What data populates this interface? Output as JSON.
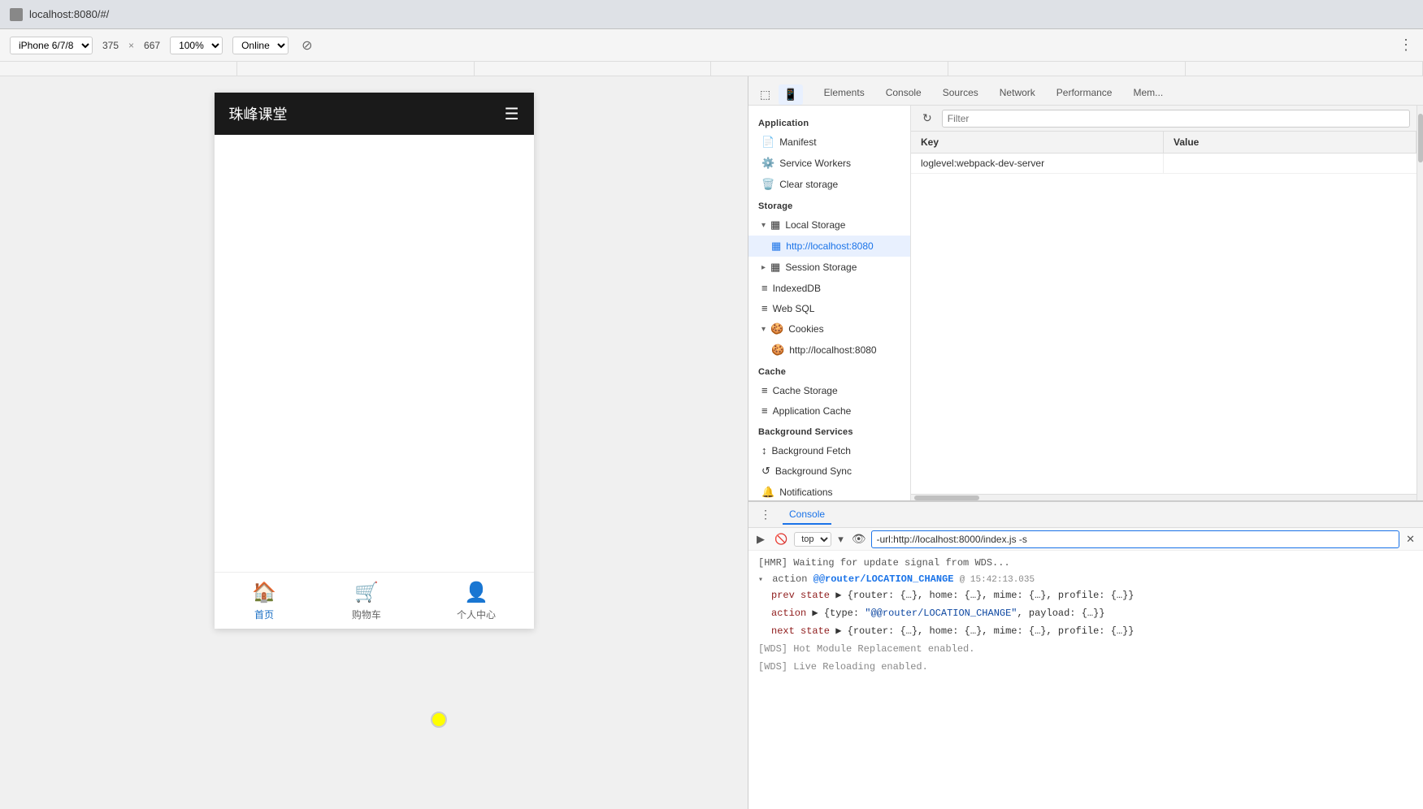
{
  "browser": {
    "url": "localhost:8080/#/",
    "favicon": "globe"
  },
  "device_toolbar": {
    "device": "iPhone 6/7/8",
    "width": "375",
    "separator": "×",
    "height": "667",
    "zoom": "100%",
    "zoom_dropdown_label": "100%",
    "network": "Online",
    "rotate_label": "⊘",
    "more_label": "⋮"
  },
  "phone": {
    "header_title": "珠峰课堂",
    "menu_icon": "☰",
    "nav_items": [
      {
        "label": "首页",
        "active": true
      },
      {
        "label": "购物车",
        "active": false
      },
      {
        "label": "个人中心",
        "active": false
      }
    ]
  },
  "devtools": {
    "tabs": [
      {
        "label": "Elements"
      },
      {
        "label": "Console"
      },
      {
        "label": "Sources"
      },
      {
        "label": "Network"
      },
      {
        "label": "Performance"
      },
      {
        "label": "Mem..."
      }
    ],
    "active_tab": "Elements",
    "toolbar_icons": [
      "inspect",
      "device"
    ],
    "application_panel": {
      "title": "Application",
      "sections": [
        {
          "label": "",
          "items": [
            {
              "label": "Manifest",
              "icon": "📄",
              "indent": 0
            },
            {
              "label": "Service Workers",
              "icon": "⚙️",
              "indent": 0
            },
            {
              "label": "Clear storage",
              "icon": "🗑️",
              "indent": 0
            }
          ]
        },
        {
          "label": "Storage",
          "items": [
            {
              "label": "Local Storage",
              "icon": "▦",
              "indent": 0,
              "expanded": true
            },
            {
              "label": "http://localhost:8080",
              "icon": "▦",
              "indent": 1,
              "active": true
            },
            {
              "label": "Session Storage",
              "icon": "▦",
              "indent": 0,
              "expanded": false
            },
            {
              "label": "IndexedDB",
              "icon": "≡",
              "indent": 0
            },
            {
              "label": "Web SQL",
              "icon": "≡",
              "indent": 0
            },
            {
              "label": "Cookies",
              "icon": "🍪",
              "indent": 0,
              "expanded": true
            },
            {
              "label": "http://localhost:8080",
              "icon": "🍪",
              "indent": 1
            }
          ]
        },
        {
          "label": "Cache",
          "items": [
            {
              "label": "Cache Storage",
              "icon": "≡",
              "indent": 0
            },
            {
              "label": "Application Cache",
              "icon": "≡",
              "indent": 0
            }
          ]
        },
        {
          "label": "Background Services",
          "items": [
            {
              "label": "Background Fetch",
              "icon": "↕",
              "indent": 0
            },
            {
              "label": "Background Sync",
              "icon": "↺",
              "indent": 0
            },
            {
              "label": "Notifications",
              "icon": "🔔",
              "indent": 0
            }
          ]
        }
      ],
      "filter_placeholder": "Filter",
      "storage_table": {
        "columns": [
          "Key",
          "Value"
        ],
        "rows": [
          {
            "key": "loglevel:webpack-dev-server",
            "value": ""
          }
        ]
      }
    },
    "console": {
      "tab_label": "Console",
      "toolbar": {
        "context": "top",
        "input_value": "-url:http://localhost:8000/index.js -s",
        "eye_icon": "👁"
      },
      "lines": [
        {
          "type": "hmr",
          "text": "[HMR] Waiting for update signal from WDS..."
        },
        {
          "type": "action-expand",
          "prefix": "action",
          "highlight": "@@router/LOCATION_CHANGE",
          "suffix": " @ 15:42:13.035",
          "expanded": true
        },
        {
          "type": "indent",
          "key": "prev state",
          "value": "▶ {router: {…}, home: {…}, mime: {…}, profile: {…}}"
        },
        {
          "type": "indent",
          "key": "action",
          "value": "▶ {type: \"@@router/LOCATION_CHANGE\", payload: {…}}"
        },
        {
          "type": "indent",
          "key": "next state",
          "value": "▶ {router: {…}, home: {…}, mime: {…}, profile: {…}}"
        },
        {
          "type": "wds",
          "text": "[WDS] Hot Module Replacement enabled."
        },
        {
          "type": "wds",
          "text": "[WDS] Live Reloading enabled."
        }
      ]
    }
  }
}
